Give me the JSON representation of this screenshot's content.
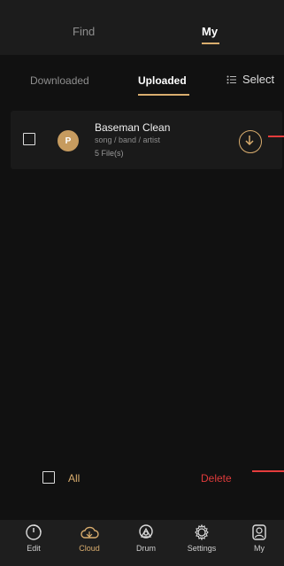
{
  "top_tabs": {
    "find": "Find",
    "my": "My"
  },
  "sub_tabs": {
    "downloaded": "Downloaded",
    "uploaded": "Uploaded",
    "select": "Select"
  },
  "file": {
    "avatar_letter": "P",
    "title": "Baseman Clean",
    "meta": "song / band / artist",
    "count": "5 File(s)"
  },
  "bottom_actions": {
    "all": "All",
    "delete": "Delete"
  },
  "tabbar": [
    {
      "label": "Edit",
      "icon": "edit-icon"
    },
    {
      "label": "Cloud",
      "icon": "cloud-icon"
    },
    {
      "label": "Drum",
      "icon": "drum-icon"
    },
    {
      "label": "Settings",
      "icon": "settings-icon"
    },
    {
      "label": "My",
      "icon": "my-icon"
    }
  ],
  "colors": {
    "accent": "#d9ad6e",
    "delete": "#df3b3b"
  }
}
